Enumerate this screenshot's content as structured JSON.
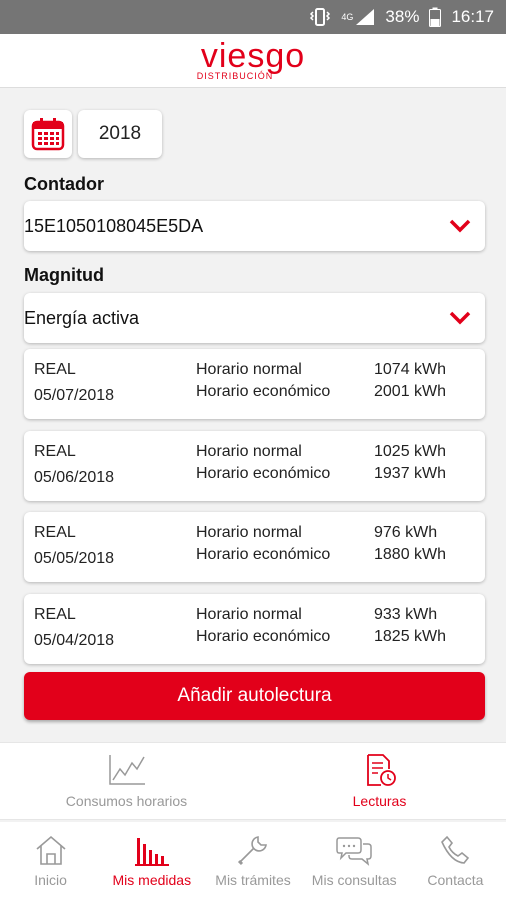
{
  "status_bar": {
    "network": "4G",
    "battery": "38%",
    "time": "16:17",
    "icons": [
      "vibrate-icon",
      "signal-icon",
      "battery-icon"
    ]
  },
  "app": {
    "logo_main": "viesgo",
    "logo_sub": "DISTRIBUCIÓN",
    "brand_color": "#e2001a"
  },
  "filters": {
    "calendar_icon": "calendar-icon",
    "year": "2018",
    "contador_label": "Contador",
    "contador_value": "15E1050108045E5DA",
    "magnitud_label": "Magnitud",
    "magnitud_value": "Energía activa"
  },
  "readings": [
    {
      "type": "REAL",
      "date": "05/07/2018",
      "tariff1": "Horario normal",
      "value1": "1074 kWh",
      "tariff2": "Horario económico",
      "value2": "2001 kWh"
    },
    {
      "type": "REAL",
      "date": "05/06/2018",
      "tariff1": "Horario normal",
      "value1": "1025 kWh",
      "tariff2": "Horario económico",
      "value2": "1937 kWh"
    },
    {
      "type": "REAL",
      "date": "05/05/2018",
      "tariff1": "Horario normal",
      "value1": "976 kWh",
      "tariff2": "Horario económico",
      "value2": "1880 kWh"
    },
    {
      "type": "REAL",
      "date": "05/04/2018",
      "tariff1": "Horario normal",
      "value1": "933 kWh",
      "tariff2": "Horario económico",
      "value2": "1825 kWh"
    }
  ],
  "add_button": "Añadir autolectura",
  "subtabs": [
    {
      "label": "Consumos horarios",
      "icon": "line-chart-icon",
      "active": false
    },
    {
      "label": "Lecturas",
      "icon": "document-clock-icon",
      "active": true
    }
  ],
  "bottom_nav": [
    {
      "label": "Inicio",
      "icon": "home-icon",
      "active": false
    },
    {
      "label": "Mis medidas",
      "icon": "bar-chart-icon",
      "active": true
    },
    {
      "label": "Mis trámites",
      "icon": "wrench-icon",
      "active": false
    },
    {
      "label": "Mis consultas",
      "icon": "chat-bubbles-icon",
      "active": false
    },
    {
      "label": "Contacta",
      "icon": "phone-icon",
      "active": false
    }
  ]
}
